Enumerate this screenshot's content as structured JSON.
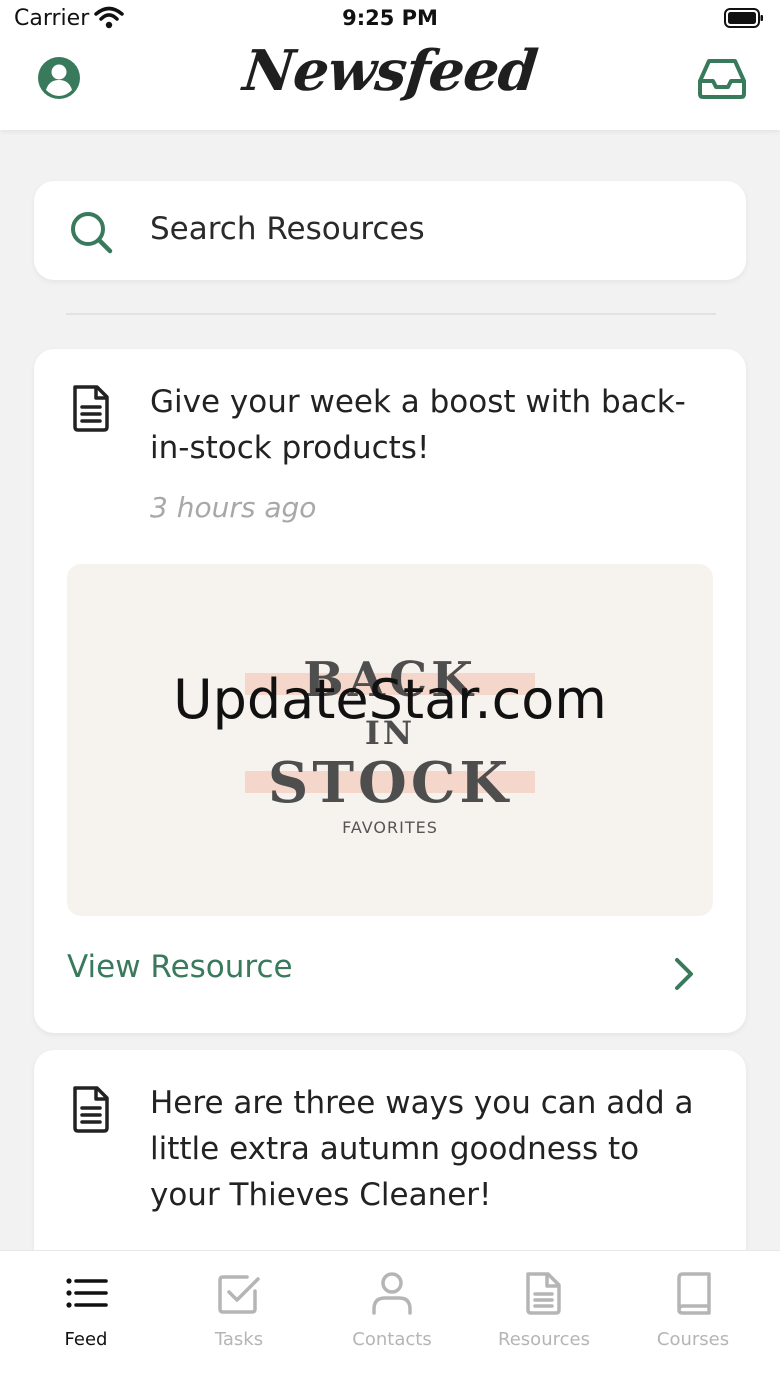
{
  "status_bar": {
    "carrier": "Carrier",
    "time": "9:25 PM"
  },
  "header": {
    "title": "Newsfeed",
    "accent_color": "#3a7a5c",
    "left_icon": "account-circle-icon",
    "right_icon": "inbox-icon"
  },
  "search": {
    "placeholder": "Search Resources",
    "icon": "search-icon"
  },
  "feed": [
    {
      "title": "Give your week a boost with back-in-stock products!",
      "time_ago": "3 hours ago",
      "image": {
        "line1": "BACK",
        "line2": "IN",
        "line3": "STOCK",
        "line4": "FAVORITES",
        "watermark": "UpdateStar.com"
      },
      "action_label": "View Resource",
      "icon": "document-icon"
    },
    {
      "title": "Here are three ways you can add a little extra autumn goodness to your Thieves Cleaner!",
      "icon": "document-icon"
    }
  ],
  "tabs": [
    {
      "label": "Feed",
      "icon": "list-icon",
      "active": true
    },
    {
      "label": "Tasks",
      "icon": "checkbox-icon",
      "active": false
    },
    {
      "label": "Contacts",
      "icon": "person-icon",
      "active": false
    },
    {
      "label": "Resources",
      "icon": "document-icon",
      "active": false
    },
    {
      "label": "Courses",
      "icon": "book-icon",
      "active": false
    }
  ]
}
